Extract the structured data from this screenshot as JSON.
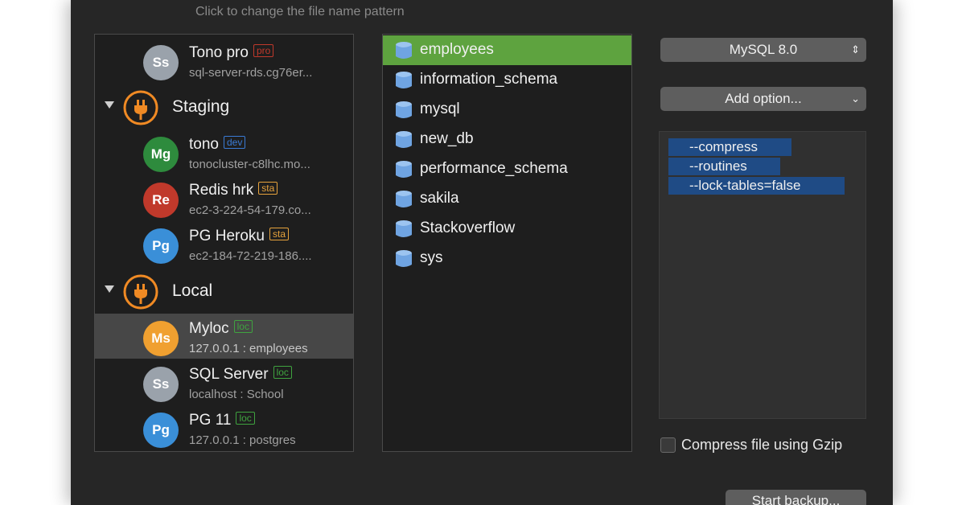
{
  "hint": "Click to change the file name pattern",
  "connections": {
    "items": [
      {
        "initials": "Ss",
        "name": "Tono pro",
        "tag": "pro",
        "sub": "sql-server-rds.cg76er...",
        "color": "#9aa2ab",
        "tag_color": "#c0392b"
      },
      {
        "group": "Staging",
        "icon": "plug-icon"
      },
      {
        "initials": "Mg",
        "name": "tono",
        "tag": "dev",
        "sub": "tonocluster-c8lhc.mo...",
        "color": "#2e8b3d",
        "tag_color": "#3a7bd5"
      },
      {
        "initials": "Re",
        "name": "Redis hrk",
        "tag": "sta",
        "sub": "ec2-3-224-54-179.co...",
        "color": "#c0392b",
        "tag_color": "#e6a23c"
      },
      {
        "initials": "Pg",
        "name": "PG Heroku",
        "tag": "sta",
        "sub": "ec2-184-72-219-186....",
        "color": "#3a8fd8",
        "tag_color": "#e6a23c"
      },
      {
        "group": "Local",
        "icon": "plug-icon"
      },
      {
        "initials": "Ms",
        "name": "Myloc",
        "tag": "loc",
        "sub": "127.0.0.1 : employees",
        "color": "#f0a030",
        "tag_color": "#3fa33f",
        "selected": true
      },
      {
        "initials": "Ss",
        "name": "SQL Server",
        "tag": "loc",
        "sub": "localhost : School",
        "color": "#9aa2ab",
        "tag_color": "#3fa33f"
      },
      {
        "initials": "Pg",
        "name": "PG 11",
        "tag": "loc",
        "sub": "127.0.0.1 : postgres",
        "color": "#3a8fd8",
        "tag_color": "#3fa33f"
      }
    ]
  },
  "databases": {
    "selected": "employees",
    "items": [
      "employees",
      "information_schema",
      "mysql",
      "new_db",
      "performance_schema",
      "sakila",
      "Stackoverflow",
      "sys"
    ]
  },
  "version_select": {
    "value": "MySQL 8.0"
  },
  "add_option": {
    "value": "Add option..."
  },
  "options": [
    "--compress",
    "--routines",
    "--lock-tables=false"
  ],
  "gzip_label": "Compress file using Gzip",
  "start_button": "Start backup...",
  "colors": {
    "accent_green": "#5ea33f",
    "option_blue": "#1f4b85",
    "plug_orange": "#f08a24"
  }
}
